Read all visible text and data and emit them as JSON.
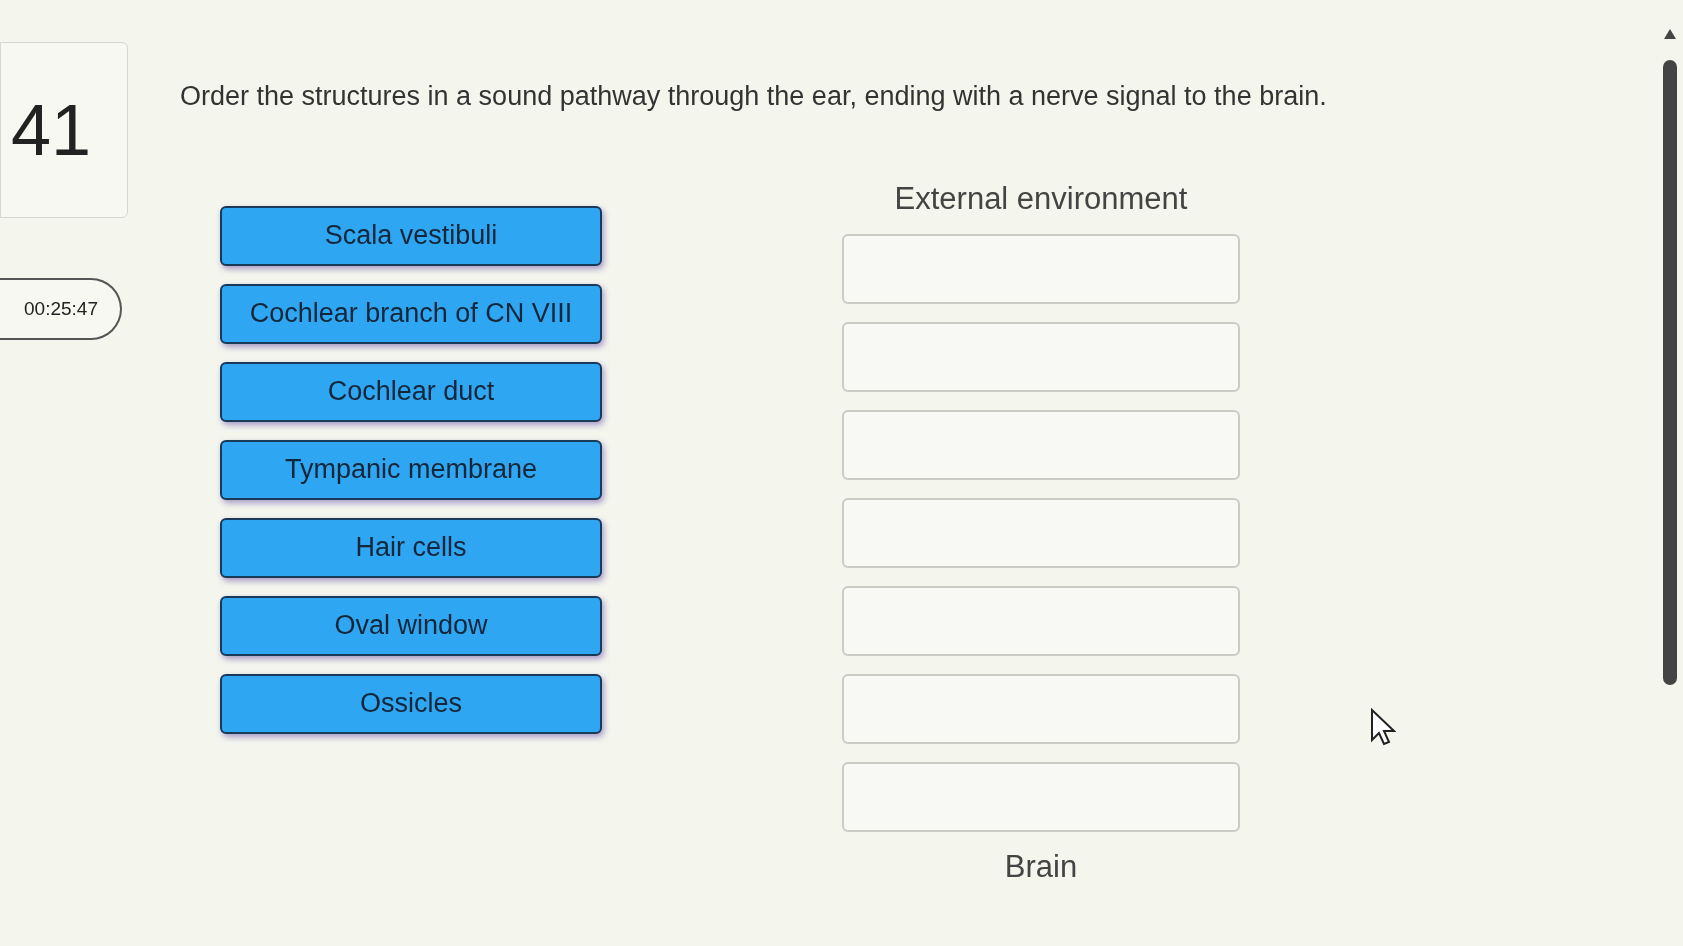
{
  "question": {
    "number": "41",
    "timer": "00:25:47",
    "prompt": "Order the structures in a sound pathway through the ear, ending with a nerve signal to the brain."
  },
  "choices": [
    {
      "label": "Scala vestibuli"
    },
    {
      "label": "Cochlear branch of CN VIII"
    },
    {
      "label": "Cochlear duct"
    },
    {
      "label": "Tympanic membrane"
    },
    {
      "label": "Hair cells"
    },
    {
      "label": "Oval window"
    },
    {
      "label": "Ossicles"
    }
  ],
  "sequence": {
    "start_label": "External environment",
    "slots": [
      {
        "kind": "empty"
      },
      {
        "kind": "empty"
      },
      {
        "kind": "empty"
      },
      {
        "kind": "empty"
      },
      {
        "kind": "empty"
      },
      {
        "kind": "empty"
      },
      {
        "kind": "empty"
      }
    ],
    "end_label": "Brain"
  }
}
